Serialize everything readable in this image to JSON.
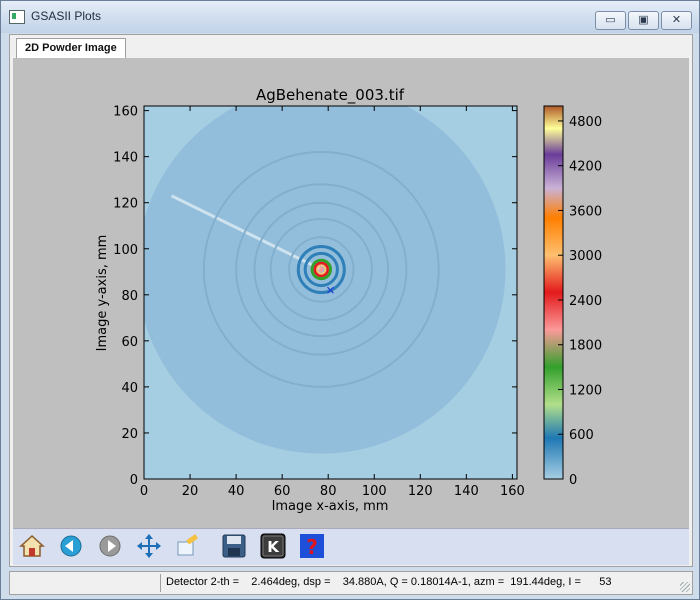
{
  "window": {
    "title": "GSASII Plots",
    "minimize_glyph": "▭",
    "maximize_glyph": "▣",
    "close_glyph": "✕"
  },
  "tabs": [
    {
      "label": "2D Powder Image",
      "active": true
    }
  ],
  "plot": {
    "title": "AgBehenate_003.tif",
    "xlabel": "Image x-axis, mm",
    "ylabel": "Image y-axis, mm",
    "xticks": [
      "0",
      "20",
      "40",
      "60",
      "80",
      "100",
      "120",
      "140",
      "160"
    ],
    "yticks": [
      "0",
      "20",
      "40",
      "60",
      "80",
      "100",
      "120",
      "140",
      "160"
    ],
    "xlim": [
      0,
      162
    ],
    "ylim": [
      0,
      162
    ],
    "beam_center": [
      77,
      91
    ],
    "rings_mm": [
      7,
      10,
      14,
      22,
      29,
      37,
      51
    ],
    "image_radius_mm": 80,
    "colorbar": {
      "ticks": [
        "0",
        "600",
        "1200",
        "1800",
        "2400",
        "3000",
        "3600",
        "4200",
        "4800"
      ],
      "range": [
        0,
        5000
      ],
      "colormap": "Paired"
    }
  },
  "toolbar": {
    "tools": [
      "home-icon",
      "back-icon",
      "forward-icon",
      "pan-icon",
      "edit-icon",
      "save-icon",
      "key-icon",
      "help-icon"
    ]
  },
  "status": {
    "text": "Detector 2-th =    2.464deg, dsp =    34.880A, Q = 0.18014A-1, azm =  191.44deg, I =      53"
  }
}
